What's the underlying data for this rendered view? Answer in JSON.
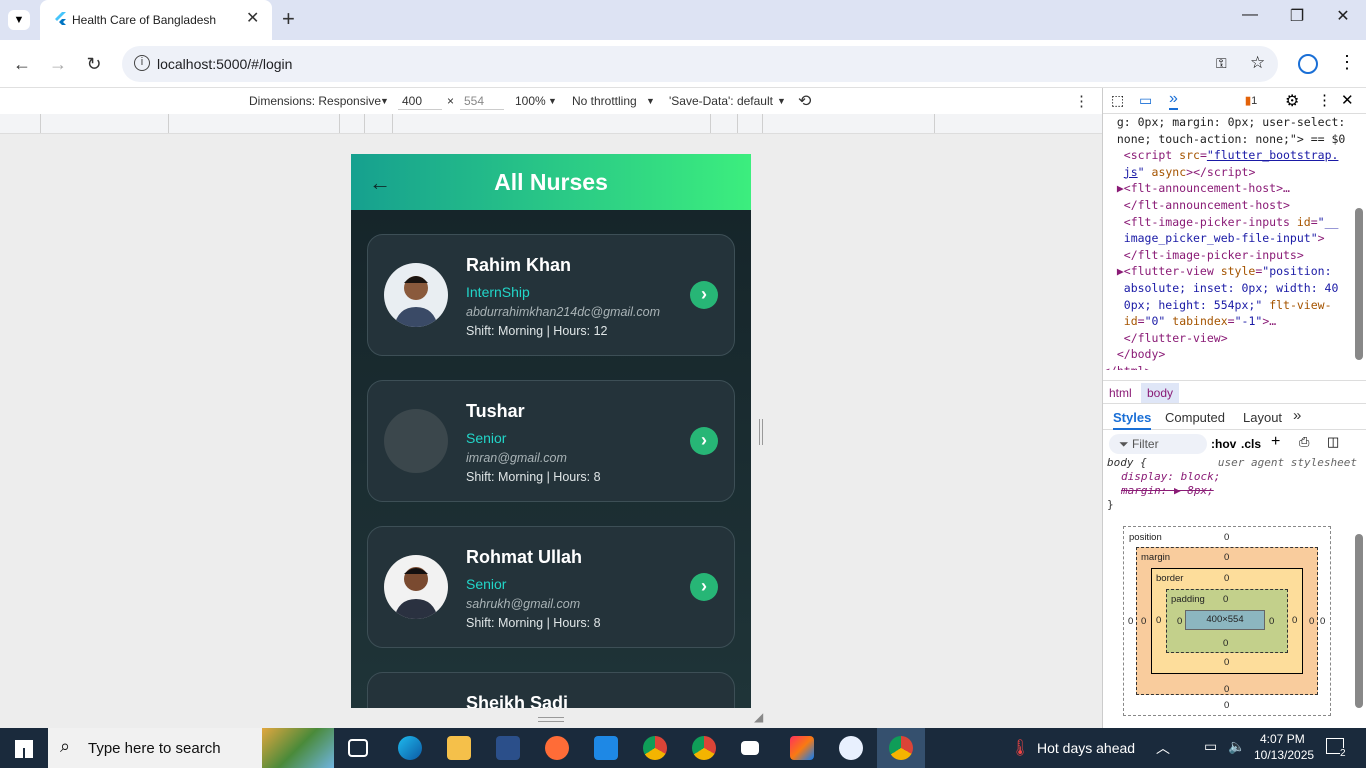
{
  "browser": {
    "tab_title": "Health Care of Bangladesh",
    "url": "localhost:5000/#/login"
  },
  "device_toolbar": {
    "dimensions": "Dimensions: Responsive",
    "width": "400",
    "height": "554",
    "zoom": "100%",
    "throttle": "No throttling",
    "save_data": "'Save-Data': default"
  },
  "app": {
    "title": "All Nurses",
    "nurses": [
      {
        "name": "Rahim Khan",
        "role": "InternShip",
        "email": "abdurrahimkhan214dc@gmail.com",
        "shift": "Shift: Morning | Hours: 12"
      },
      {
        "name": "Tushar",
        "role": "Senior",
        "email": "imran@gmail.com",
        "shift": "Shift: Morning | Hours: 8"
      },
      {
        "name": "Rohmat Ullah",
        "role": "Senior",
        "email": "sahrukh@gmail.com",
        "shift": "Shift: Morning | Hours: 8"
      },
      {
        "name": "Sheikh Sadi"
      }
    ]
  },
  "devtools": {
    "issue_count": "1",
    "crumb_html": "html",
    "crumb_body": "body",
    "tab_styles": "Styles",
    "tab_computed": "Computed",
    "tab_layout": "Layout",
    "filter_placeholder": "Filter",
    "hov": ":hov",
    "cls": ".cls",
    "rule_selector": "body {",
    "rule_source": "user agent stylesheet",
    "rule_display": "display: block;",
    "rule_margin": "margin: ▶ 8px;",
    "rule_close": "}",
    "box": {
      "position": "position",
      "margin": "margin",
      "border": "border",
      "padding": "padding",
      "content": "400×554",
      "zero": "0"
    }
  },
  "taskbar": {
    "search_placeholder": "Type here to search",
    "weather": "Hot days ahead",
    "time": "4:07 PM",
    "date": "10/13/2025",
    "notif_count": "2"
  }
}
